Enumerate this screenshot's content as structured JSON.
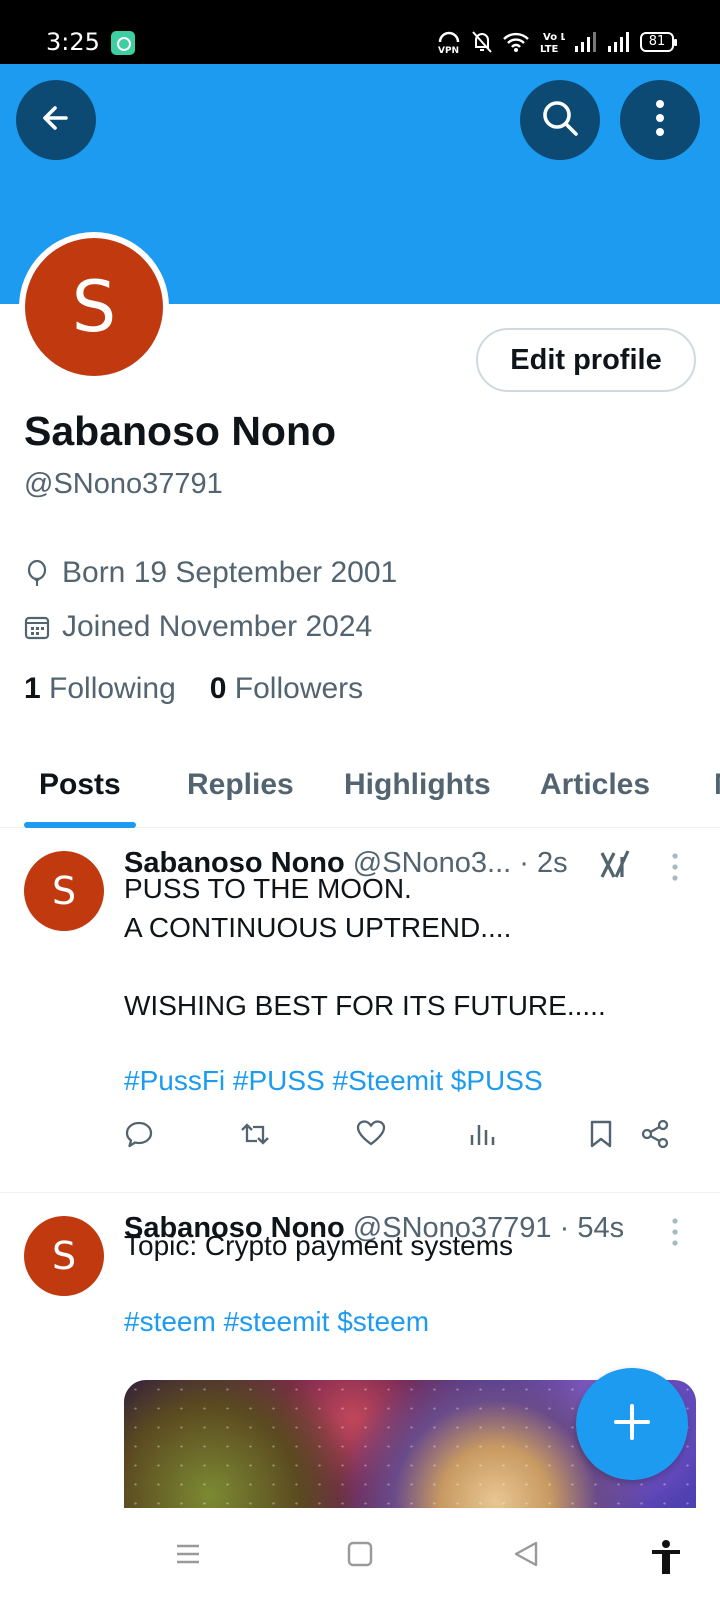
{
  "status_bar": {
    "time": "3:25",
    "battery": "81",
    "volte_label": "Vo LTE",
    "icons": [
      "app-notification-icon",
      "vpn-icon",
      "bell-off-icon",
      "wifi-icon",
      "volte-icon",
      "signal-icon",
      "signal-icon",
      "battery-icon"
    ]
  },
  "header": {
    "banner_color": "#1d9bf0",
    "icons": [
      "back-arrow-icon",
      "search-icon",
      "more-vertical-icon"
    ]
  },
  "profile": {
    "avatar_letter": "S",
    "avatar_color": "#c1390f",
    "edit_label": "Edit profile",
    "display_name": "Sabanoso Nono",
    "handle": "@SNono37791",
    "born": "Born 19 September 2001",
    "joined": "Joined November 2024",
    "following_count": "1",
    "following_label": "Following",
    "followers_count": "0",
    "followers_label": "Followers"
  },
  "tabs": [
    {
      "label": "Posts",
      "active": true
    },
    {
      "label": "Replies",
      "active": false
    },
    {
      "label": "Highlights",
      "active": false
    },
    {
      "label": "Articles",
      "active": false
    },
    {
      "label": "M",
      "active": false
    }
  ],
  "posts": [
    {
      "avatar_letter": "S",
      "name": "Sabanoso Nono",
      "handle_time": "@SNono3... · 2s",
      "text_lines": [
        "PUSS TO THE MOON.",
        "A CONTINUOUS UPTREND....",
        "",
        "WISHING BEST FOR ITS FUTURE....."
      ],
      "hashtags": "#PussFi #PUSS #Steemit $PUSS",
      "actions": [
        "reply-icon",
        "repost-icon",
        "like-icon",
        "views-icon",
        "bookmark-icon",
        "share-icon"
      ]
    },
    {
      "avatar_letter": "S",
      "name": "Sabanoso Nono",
      "handle_time": "@SNono37791 · 54s",
      "text_lines": [
        "Topic: Crypto payment systems"
      ],
      "hashtags": "#steem #steemit $steem",
      "image": "space-earth-image"
    }
  ],
  "accent_color": "#1d9bf0",
  "nav_bar": {
    "icons": [
      "recent-apps-icon",
      "home-square-icon",
      "back-triangle-icon",
      "accessibility-icon"
    ]
  }
}
